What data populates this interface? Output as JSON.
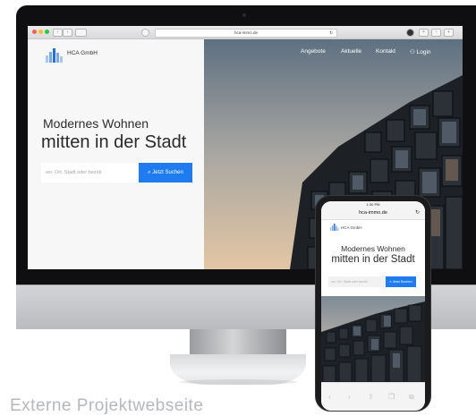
{
  "desktop": {
    "url": "hca-immo.de",
    "brand": "HCA GmbH",
    "nav": [
      "Angebote",
      "Aktuelle",
      "Kontakt"
    ],
    "login": "Login",
    "headline_1": "Modernes Wohnen",
    "headline_2": "mitten in der Stadt",
    "search_placeholder": "wo: Ort, Stadt oder bezirk",
    "search_button": "Jetzt Suchen"
  },
  "phone": {
    "time": "1:30 PM",
    "url": "hca-immo.de",
    "brand": "HCA GmbH",
    "headline_1": "Modernes Wohnen",
    "headline_2": "mitten in der Stadt",
    "search_placeholder": "wo: Ort, Stadt oder bezirk",
    "search_button": "Jetzt Suchen"
  },
  "caption": "Externe Projektwebseite",
  "colors": {
    "accent": "#1e7cf0",
    "logo_light": "#a9c6f2",
    "logo_dark": "#2a6fd6"
  }
}
